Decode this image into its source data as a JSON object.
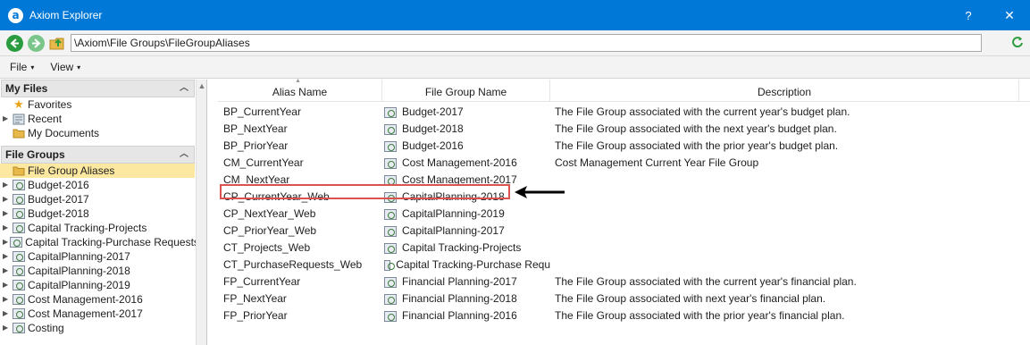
{
  "window": {
    "title": "Axiom Explorer",
    "app_icon": "a",
    "help": "?",
    "close": "✕"
  },
  "address": {
    "path": "\\Axiom\\File Groups\\FileGroupAliases"
  },
  "menu": {
    "file": "File",
    "view": "View"
  },
  "sidebar": {
    "my_files": {
      "header": "My Files",
      "items": [
        {
          "label": "Favorites",
          "icon": "star-icon"
        },
        {
          "label": "Recent",
          "icon": "recent-icon"
        },
        {
          "label": "My Documents",
          "icon": "folder-icon"
        }
      ]
    },
    "file_groups": {
      "header": "File Groups",
      "items": [
        {
          "label": "File Group Aliases",
          "icon": "folder-icon",
          "selected": true
        },
        {
          "label": "Budget-2016",
          "icon": "file-group-icon"
        },
        {
          "label": "Budget-2017",
          "icon": "file-group-icon"
        },
        {
          "label": "Budget-2018",
          "icon": "file-group-icon"
        },
        {
          "label": "Capital Tracking-Projects",
          "icon": "file-group-icon"
        },
        {
          "label": "Capital Tracking-Purchase Requests",
          "icon": "file-group-icon"
        },
        {
          "label": "CapitalPlanning-2017",
          "icon": "file-group-icon"
        },
        {
          "label": "CapitalPlanning-2018",
          "icon": "file-group-icon"
        },
        {
          "label": "CapitalPlanning-2019",
          "icon": "file-group-icon"
        },
        {
          "label": "Cost Management-2016",
          "icon": "file-group-icon"
        },
        {
          "label": "Cost Management-2017",
          "icon": "file-group-icon"
        },
        {
          "label": "Costing",
          "icon": "file-group-icon"
        }
      ]
    }
  },
  "table": {
    "columns": {
      "alias": "Alias Name",
      "file_group": "File Group Name",
      "description": "Description"
    },
    "rows": [
      {
        "alias": "BP_CurrentYear",
        "file_group": "Budget-2017",
        "description": "The File Group associated with the current year's budget plan."
      },
      {
        "alias": "BP_NextYear",
        "file_group": "Budget-2018",
        "description": "The File Group associated with the next year's budget plan."
      },
      {
        "alias": "BP_PriorYear",
        "file_group": "Budget-2016",
        "description": "The File Group associated with the prior year's budget plan."
      },
      {
        "alias": "CM_CurrentYear",
        "file_group": "Cost Management-2016",
        "description": "Cost Management Current Year File Group"
      },
      {
        "alias": "CM_NextYear",
        "file_group": "Cost Management-2017",
        "description": ""
      },
      {
        "alias": "CP_CurrentYear_Web",
        "file_group": "CapitalPlanning-2018",
        "description": "",
        "highlighted": true
      },
      {
        "alias": "CP_NextYear_Web",
        "file_group": "CapitalPlanning-2019",
        "description": ""
      },
      {
        "alias": "CP_PriorYear_Web",
        "file_group": "CapitalPlanning-2017",
        "description": ""
      },
      {
        "alias": "CT_Projects_Web",
        "file_group": "Capital Tracking-Projects",
        "description": ""
      },
      {
        "alias": "CT_PurchaseRequests_Web",
        "file_group": "Capital Tracking-Purchase Requ",
        "description": ""
      },
      {
        "alias": "FP_CurrentYear",
        "file_group": "Financial Planning-2017",
        "description": "The File Group associated with the current year's financial plan."
      },
      {
        "alias": "FP_NextYear",
        "file_group": "Financial Planning-2018",
        "description": "The File Group associated with next year's financial plan."
      },
      {
        "alias": "FP_PriorYear",
        "file_group": "Financial Planning-2016",
        "description": "The File Group associated with the prior year's financial plan."
      }
    ]
  },
  "colors": {
    "titlebar": "#0078d7",
    "selected_item": "#fce8a0",
    "highlight_box": "#d9534f"
  }
}
